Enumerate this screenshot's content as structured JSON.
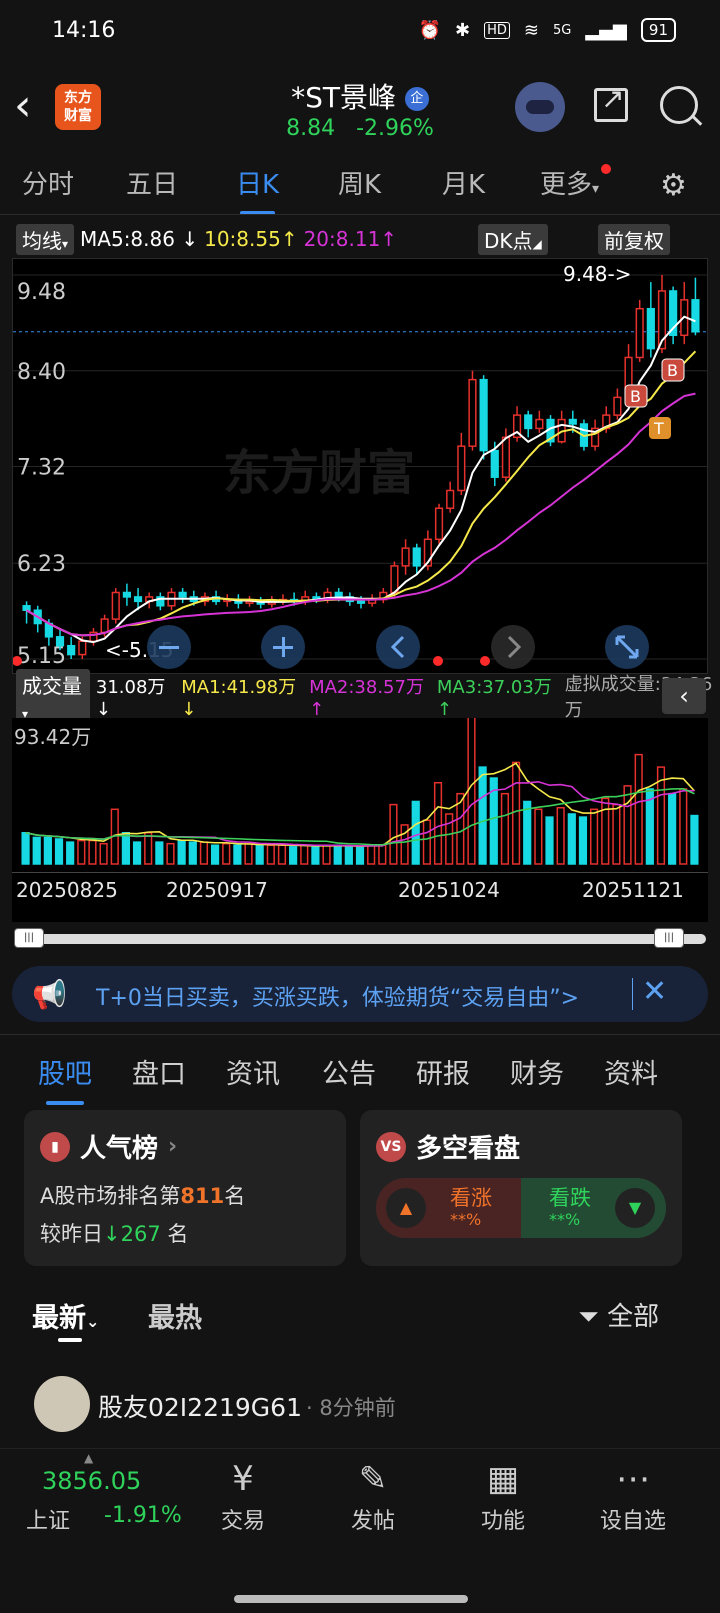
{
  "status": {
    "time": "14:16",
    "signal": "5G",
    "battery": "91"
  },
  "header": {
    "logo_line1": "东方",
    "logo_line2": "财富",
    "title": "*ST景峰",
    "badge": "企",
    "price": "8.84",
    "change": "-2.96%"
  },
  "tabs": {
    "items": [
      "分时",
      "五日",
      "日K",
      "周K",
      "月K",
      "更多"
    ],
    "active": "日K"
  },
  "ma": {
    "label": "均线",
    "ma5": "MA5:8.86",
    "ma5_arrow": "↓",
    "ma10": "10:8.55",
    "ma10_arrow": "↑",
    "ma20": "20:8.11",
    "ma20_arrow": "↑",
    "dk": "DK点",
    "adjust": "前复权"
  },
  "price_axis": [
    "9.48",
    "8.40",
    "7.32",
    "6.23",
    "5.15"
  ],
  "markers": {
    "high": "9.48->",
    "low": "<-5.15",
    "watermark": "东方财富",
    "b": "B",
    "t": "T"
  },
  "volume_bar": {
    "label": "成交量",
    "vol": "31.08万",
    "vol_arrow": "↓",
    "ma1": "MA1:41.98万",
    "ma1_arrow": "↓",
    "ma2": "MA2:38.57万",
    "ma2_arrow": "↑",
    "ma3": "MA3:37.03万",
    "ma3_arrow": "↑",
    "virtual": "虚拟成交量:34.36万",
    "max": "93.42万"
  },
  "x_axis": [
    "20250825",
    "20250917",
    "20251024",
    "20251121"
  ],
  "promo": {
    "text": "T+0当日买卖，买涨买跌，体验期货“交易自由”>"
  },
  "subtabs": {
    "items": [
      "股吧",
      "盘口",
      "资讯",
      "公告",
      "研报",
      "财务",
      "资料"
    ],
    "active": "股吧"
  },
  "popularity": {
    "title": "人气榜",
    "line1_prefix": "A股市场排名第",
    "rank": "811",
    "line1_suffix": "名",
    "line2_prefix": "较昨日",
    "change": "267",
    "line2_suffix": "名"
  },
  "sentiment": {
    "title": "多空看盘",
    "bull_label": "看涨",
    "bull_value": "**%",
    "bear_label": "看跌",
    "bear_value": "**%",
    "icon": "VS"
  },
  "feed": {
    "latest": "最新",
    "hottest": "最热",
    "filter": "全部"
  },
  "post": {
    "user": "股友02I2219G61",
    "time": "· 8分钟前"
  },
  "bottom": {
    "index_value": "3856.05",
    "index_name": "上证",
    "index_change": "-1.91%",
    "nav": [
      "交易",
      "发帖",
      "功能",
      "设自选"
    ]
  },
  "colors": {
    "up": "#e6312d",
    "down": "#16d9e3",
    "ma5": "#ffffff",
    "ma10": "#f5e84a",
    "ma20": "#d633d6",
    "accent": "#3b8cf0",
    "green": "#2fd35b"
  },
  "chart_data": {
    "type": "candlestick",
    "ylim": [
      5.15,
      9.48
    ],
    "ticks": [
      9.48,
      8.4,
      7.32,
      6.23,
      5.15
    ],
    "candles": [
      [
        5.75,
        5.7,
        5.8,
        5.55
      ],
      [
        5.7,
        5.55,
        5.75,
        5.45
      ],
      [
        5.55,
        5.4,
        5.6,
        5.3
      ],
      [
        5.4,
        5.3,
        5.5,
        5.25
      ],
      [
        5.3,
        5.2,
        5.4,
        5.15
      ],
      [
        5.2,
        5.35,
        5.4,
        5.15
      ],
      [
        5.35,
        5.45,
        5.5,
        5.3
      ],
      [
        5.45,
        5.6,
        5.65,
        5.4
      ],
      [
        5.6,
        5.9,
        5.95,
        5.55
      ],
      [
        5.9,
        5.85,
        6.0,
        5.75
      ],
      [
        5.85,
        5.8,
        5.95,
        5.7
      ],
      [
        5.8,
        5.85,
        5.9,
        5.72
      ],
      [
        5.85,
        5.75,
        5.9,
        5.7
      ],
      [
        5.75,
        5.9,
        5.95,
        5.7
      ],
      [
        5.9,
        5.85,
        5.95,
        5.78
      ],
      [
        5.85,
        5.8,
        5.92,
        5.75
      ],
      [
        5.8,
        5.85,
        5.9,
        5.75
      ],
      [
        5.85,
        5.8,
        5.92,
        5.76
      ],
      [
        5.8,
        5.82,
        5.88,
        5.74
      ],
      [
        5.82,
        5.78,
        5.88,
        5.72
      ],
      [
        5.78,
        5.8,
        5.86,
        5.74
      ],
      [
        5.8,
        5.77,
        5.85,
        5.72
      ],
      [
        5.77,
        5.8,
        5.86,
        5.73
      ],
      [
        5.8,
        5.82,
        5.88,
        5.76
      ],
      [
        5.82,
        5.8,
        5.9,
        5.75
      ],
      [
        5.8,
        5.85,
        5.92,
        5.76
      ],
      [
        5.85,
        5.82,
        5.9,
        5.78
      ],
      [
        5.82,
        5.9,
        5.95,
        5.78
      ],
      [
        5.9,
        5.85,
        5.95,
        5.8
      ],
      [
        5.85,
        5.8,
        5.9,
        5.75
      ],
      [
        5.8,
        5.78,
        5.86,
        5.72
      ],
      [
        5.78,
        5.82,
        5.88,
        5.74
      ],
      [
        5.82,
        5.9,
        5.95,
        5.78
      ],
      [
        5.9,
        6.2,
        6.25,
        5.85
      ],
      [
        6.2,
        6.4,
        6.5,
        6.1
      ],
      [
        6.4,
        6.2,
        6.45,
        6.1
      ],
      [
        6.2,
        6.5,
        6.6,
        6.15
      ],
      [
        6.5,
        6.85,
        6.9,
        6.45
      ],
      [
        6.85,
        7.05,
        7.15,
        6.8
      ],
      [
        7.05,
        7.55,
        7.7,
        7.0
      ],
      [
        7.55,
        8.3,
        8.4,
        7.5
      ],
      [
        8.3,
        7.5,
        8.35,
        7.4
      ],
      [
        7.5,
        7.2,
        7.6,
        7.1
      ],
      [
        7.2,
        7.65,
        7.75,
        7.15
      ],
      [
        7.65,
        7.9,
        8.0,
        7.6
      ],
      [
        7.9,
        7.75,
        7.95,
        7.65
      ],
      [
        7.75,
        7.85,
        7.95,
        7.7
      ],
      [
        7.85,
        7.6,
        7.9,
        7.55
      ],
      [
        7.6,
        7.85,
        7.95,
        7.58
      ],
      [
        7.85,
        7.8,
        7.95,
        7.7
      ],
      [
        7.8,
        7.55,
        7.85,
        7.5
      ],
      [
        7.55,
        7.75,
        7.85,
        7.5
      ],
      [
        7.75,
        7.9,
        8.0,
        7.7
      ],
      [
        7.9,
        8.1,
        8.2,
        7.85
      ],
      [
        8.1,
        8.55,
        8.7,
        8.05
      ],
      [
        8.55,
        9.1,
        9.2,
        8.5
      ],
      [
        9.1,
        8.65,
        9.4,
        8.55
      ],
      [
        8.65,
        9.3,
        9.48,
        8.6
      ],
      [
        9.3,
        8.8,
        9.35,
        8.7
      ],
      [
        8.8,
        9.2,
        9.4,
        8.7
      ],
      [
        9.2,
        8.84,
        9.45,
        8.8
      ]
    ],
    "volume_ylim": [
      0,
      93.42
    ],
    "volume": [
      20,
      17,
      17,
      16,
      14,
      15,
      15,
      13,
      35,
      20,
      14,
      20,
      14,
      13,
      15,
      14,
      14,
      12,
      13,
      12,
      13,
      12,
      12,
      12,
      11,
      12,
      11,
      12,
      12,
      11,
      11,
      12,
      12,
      38,
      25,
      40,
      28,
      52,
      32,
      45,
      95,
      62,
      55,
      45,
      65,
      40,
      35,
      30,
      36,
      32,
      30,
      35,
      42,
      38,
      50,
      70,
      48,
      62,
      45,
      48,
      31
    ]
  }
}
